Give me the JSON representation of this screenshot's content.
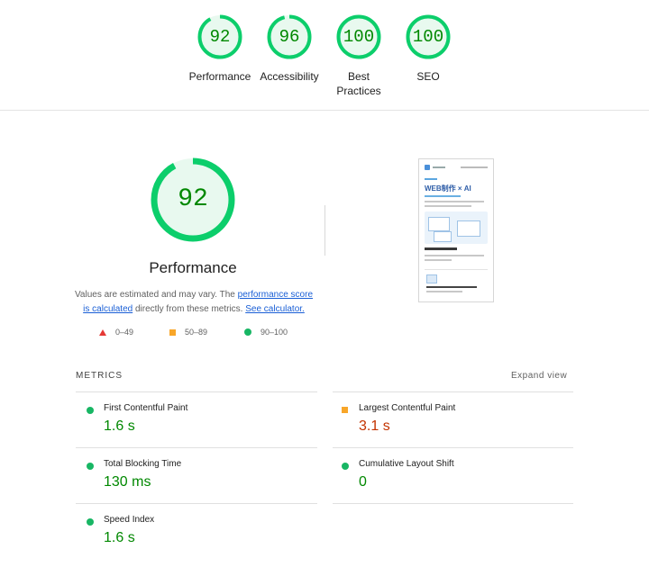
{
  "colors": {
    "pass": "#0cce6b",
    "pass_text": "#008800",
    "average": "#ffa400",
    "average_text": "#c33300",
    "fail": "#ff4e42",
    "link": "#1a5fd6"
  },
  "categories": [
    {
      "label": "Performance",
      "score": 92
    },
    {
      "label": "Accessibility",
      "score": 96
    },
    {
      "label": "Best Practices",
      "score": 100
    },
    {
      "label": "SEO",
      "score": 100
    }
  ],
  "performance": {
    "score": 92,
    "title": "Performance",
    "desc_prefix": "Values are estimated and may vary. The ",
    "desc_link1": "performance score is calculated",
    "desc_middle": " directly from these metrics. ",
    "desc_link2": "See calculator."
  },
  "legend": {
    "fail": "0–49",
    "average": "50–89",
    "pass": "90–100"
  },
  "screenshot": {
    "heading": "WEB制作 × AI"
  },
  "metrics": {
    "header": "METRICS",
    "expand": "Expand view",
    "items": [
      {
        "label": "First Contentful Paint",
        "value": "1.6 s",
        "rating": "pass"
      },
      {
        "label": "Largest Contentful Paint",
        "value": "3.1 s",
        "rating": "average"
      },
      {
        "label": "Total Blocking Time",
        "value": "130 ms",
        "rating": "pass"
      },
      {
        "label": "Cumulative Layout Shift",
        "value": "0",
        "rating": "pass"
      },
      {
        "label": "Speed Index",
        "value": "1.6 s",
        "rating": "pass"
      }
    ]
  }
}
